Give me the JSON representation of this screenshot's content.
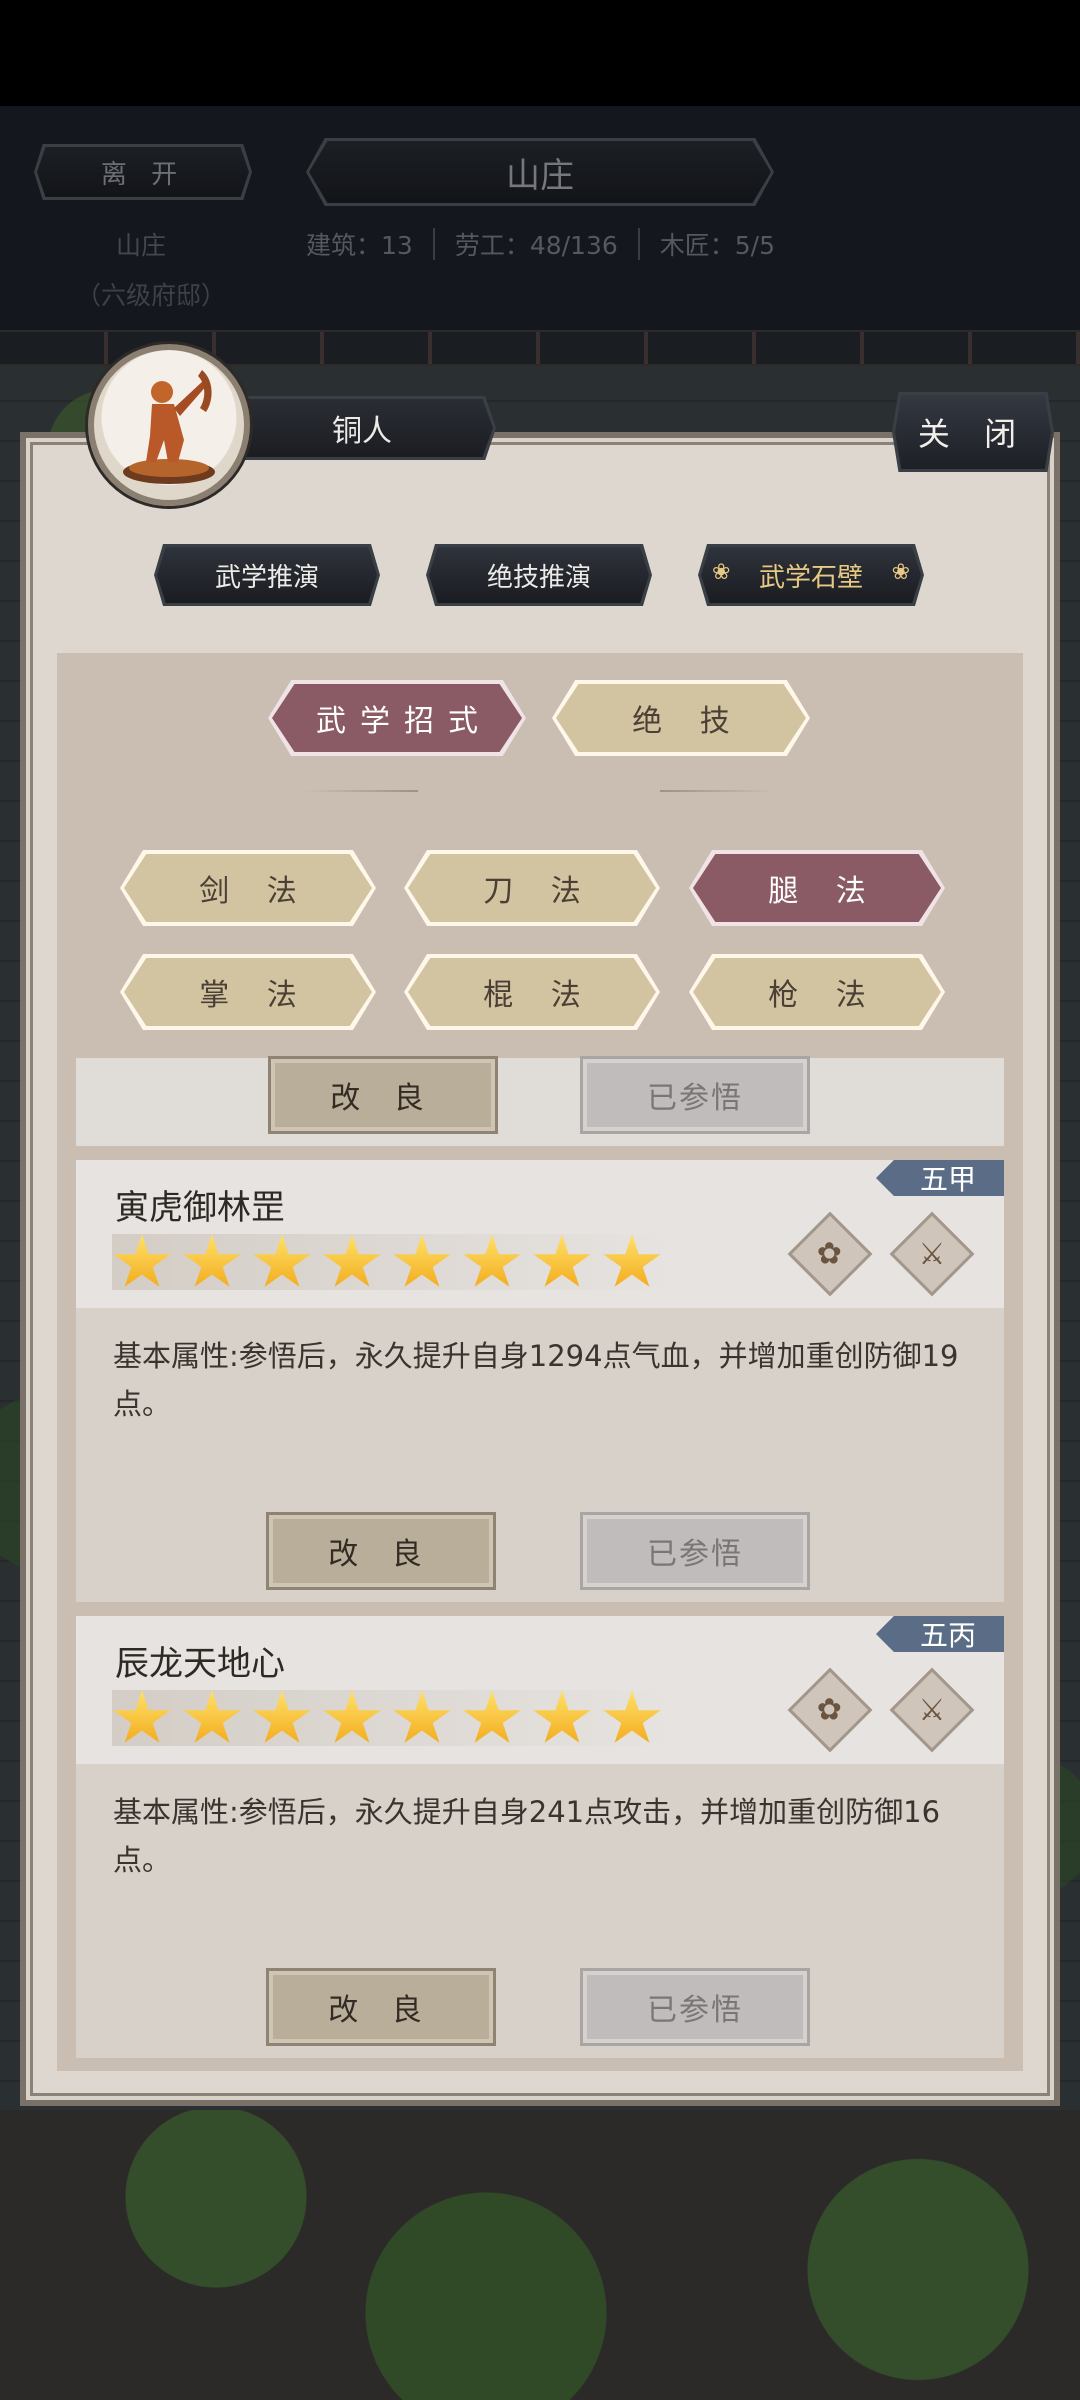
{
  "header": {
    "leave_label": "离 开",
    "title": "山庄",
    "location_name": "山庄",
    "location_level": "（六级府邸）",
    "stats": [
      "建筑：13",
      "劳工：48/136",
      "木匠：5/5"
    ]
  },
  "panel": {
    "character_name": "铜人",
    "close_label": "关 闭",
    "modes": [
      {
        "label": "武学推演",
        "active": false
      },
      {
        "label": "绝技推演",
        "active": false
      },
      {
        "label": "武学石壁",
        "active": true
      }
    ],
    "main_tabs": [
      {
        "label": "武学招式",
        "active": true
      },
      {
        "label": "绝 技",
        "active": false
      }
    ],
    "categories": [
      {
        "label": "剑 法",
        "active": false
      },
      {
        "label": "刀 法",
        "active": false
      },
      {
        "label": "腿 法",
        "active": true
      },
      {
        "label": "掌 法",
        "active": false
      },
      {
        "label": "棍 法",
        "active": false
      },
      {
        "label": "枪 法",
        "active": false
      }
    ]
  },
  "buttons": {
    "improve_label": "改 良",
    "comprehended_label": "已参悟"
  },
  "cards": [
    {
      "title": "寅虎御林罡",
      "grade": "五甲",
      "stars": 8,
      "description": "基本属性:参悟后，永久提升自身1294点气血，并增加重创防御19点。"
    },
    {
      "title": "辰龙天地心",
      "grade": "五丙",
      "stars": 8,
      "description": "基本属性:参悟后，永久提升自身241点攻击，并增加重创防御16点。"
    }
  ],
  "icons": {
    "diamond_left": "flower-icon",
    "diamond_right": "blade-icon"
  },
  "colors": {
    "active_tab": "#8a5b65",
    "inactive_tab": "#d2c3a1",
    "grade_tag": "#5a6c86",
    "star": "#f5b926"
  }
}
